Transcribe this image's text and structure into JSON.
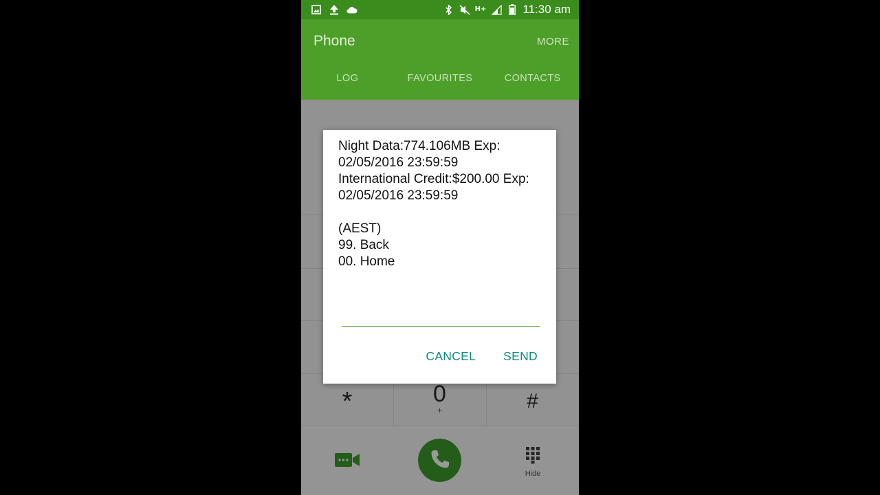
{
  "status_bar": {
    "time": "11:30 am",
    "network_type": "H+",
    "icons_left": [
      "gallery-icon",
      "upload-icon",
      "cloud-icon"
    ],
    "icons_right": [
      "bluetooth-icon",
      "mute-icon",
      "signal-icon",
      "battery-icon"
    ]
  },
  "appbar": {
    "title": "Phone",
    "more_label": "MORE",
    "tabs": [
      {
        "label": "LOG"
      },
      {
        "label": "FAVOURITES"
      },
      {
        "label": "CONTACTS"
      }
    ]
  },
  "keypad": {
    "star": "*",
    "zero": "0",
    "zero_sub": "+",
    "hash": "#",
    "hide_label": "Hide"
  },
  "dialog": {
    "message": "Night Data:774.106MB Exp:\n02/05/2016 23:59:59\nInternational Credit:$200.00 Exp:\n02/05/2016 23:59:59\n\n(AEST)\n99. Back\n00. Home",
    "input_value": "",
    "cancel_label": "CANCEL",
    "send_label": "SEND"
  },
  "colors": {
    "status_bar": "#3a8d1c",
    "app_bar": "#4d9f2a",
    "call_button": "#3d9c2c",
    "dialog_button_text": "#0b8b7f"
  }
}
